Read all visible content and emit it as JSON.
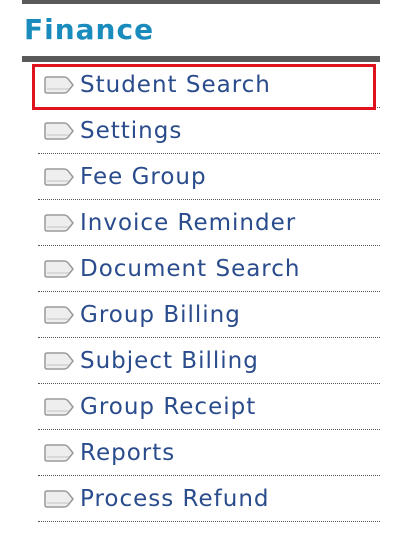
{
  "section": {
    "title": "Finance"
  },
  "menu": {
    "selected_index": 0,
    "items": [
      {
        "label": "Student Search",
        "icon": "tab-icon"
      },
      {
        "label": "Settings",
        "icon": "tab-icon"
      },
      {
        "label": "Fee Group",
        "icon": "tab-icon"
      },
      {
        "label": "Invoice Reminder",
        "icon": "tab-icon"
      },
      {
        "label": "Document Search",
        "icon": "tab-icon"
      },
      {
        "label": "Group Billing",
        "icon": "tab-icon"
      },
      {
        "label": "Subject Billing",
        "icon": "tab-icon"
      },
      {
        "label": "Group Receipt",
        "icon": "tab-icon"
      },
      {
        "label": "Reports",
        "icon": "tab-icon"
      },
      {
        "label": "Process Refund",
        "icon": "tab-icon"
      }
    ]
  },
  "colors": {
    "title": "#1a8bbd",
    "link": "#2a4c8c",
    "rule": "#5a5a5a",
    "highlight": "#e0121e"
  }
}
